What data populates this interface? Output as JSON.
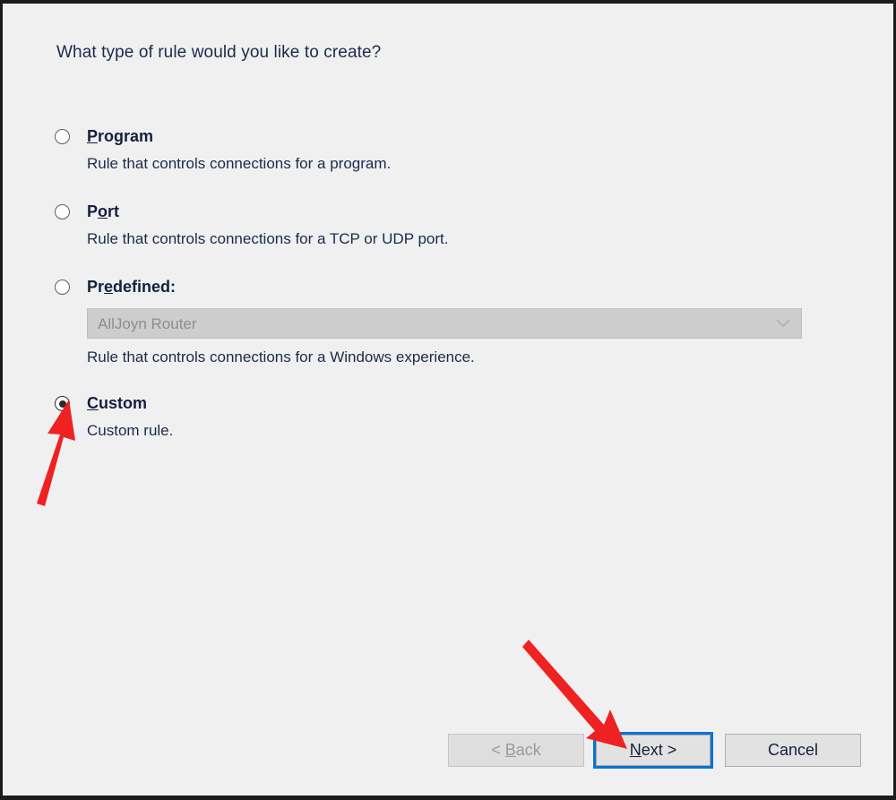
{
  "window": {
    "heading": "What type of rule would you like to create?"
  },
  "rule_types": {
    "options": [
      {
        "name": "program",
        "label_before": "P",
        "label_accel": "P",
        "label": "Program",
        "label_head": "P",
        "label_tail": "rogram",
        "description": "Rule that controls connections for a program.",
        "selected": false
      },
      {
        "name": "port",
        "label": "Port",
        "label_head": "P",
        "label_accel": "o",
        "label_tail": "rt",
        "description": "Rule that controls connections for a TCP or UDP port.",
        "selected": false
      },
      {
        "name": "predefined",
        "label": "Predefined:",
        "label_head": "Pr",
        "label_accel": "e",
        "label_tail": "defined:",
        "description": "Rule that controls connections for a Windows experience.",
        "selected": false
      },
      {
        "name": "custom",
        "label": "Custom",
        "label_head": "",
        "label_accel": "C",
        "label_tail": "ustom",
        "description": "Custom rule.",
        "selected": true
      }
    ]
  },
  "predefined_select": {
    "value": "AllJoyn Router",
    "enabled": false,
    "chevron_icon": "chevron-down-icon"
  },
  "footer": {
    "back": {
      "label": "< Back",
      "head": "< ",
      "accel": "B",
      "tail": "ack",
      "enabled": false
    },
    "next": {
      "label": "Next >",
      "head": "",
      "accel": "N",
      "tail": "ext >",
      "focused": true
    },
    "cancel": {
      "label": "Cancel",
      "head": "Cance",
      "accel": "",
      "tail": "l"
    }
  },
  "annotations": {
    "arrow_color": "#ee2222",
    "arrows": [
      {
        "name": "arrow-to-custom-radio",
        "points_to": "custom"
      },
      {
        "name": "arrow-to-next-button",
        "points_to": "next"
      }
    ]
  }
}
